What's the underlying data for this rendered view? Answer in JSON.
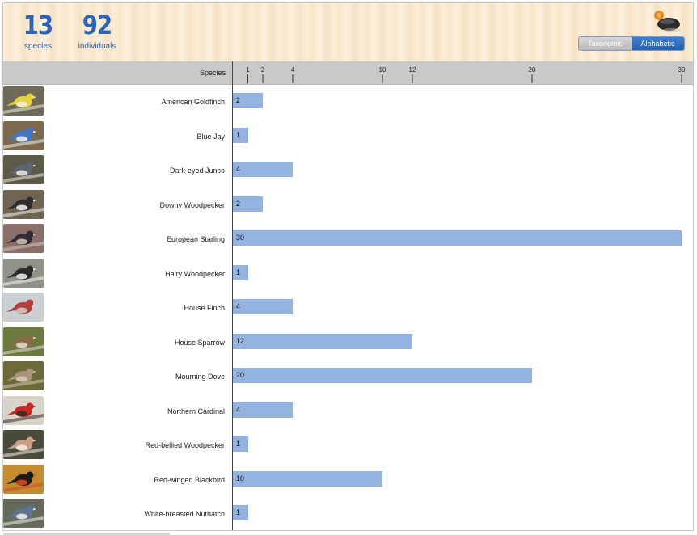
{
  "summary": {
    "species_count": "13",
    "species_label": "species",
    "individuals_count": "92",
    "individuals_label": "individuals"
  },
  "view_toggle": {
    "taxonomic": "Taxonomic",
    "alphabetic": "Alphabetic",
    "selected": "Alphabetic"
  },
  "column_header": "Species",
  "colors": {
    "bar": "#95b3e0",
    "accent": "#2a63b8",
    "header_bg": "#c9c9c9"
  },
  "chart_data": {
    "type": "bar",
    "orientation": "horizontal",
    "xlabel": "",
    "ylabel": "Species",
    "xlim": [
      0,
      30
    ],
    "ticks": [
      1,
      2,
      4,
      10,
      12,
      20,
      30
    ],
    "categories": [
      "American Goldfinch",
      "Blue Jay",
      "Dark-eyed Junco",
      "Downy Woodpecker",
      "European Starling",
      "Hairy Woodpecker",
      "House Finch",
      "House Sparrow",
      "Mourning Dove",
      "Northern Cardinal",
      "Red-bellied Woodpecker",
      "Red-winged Blackbird",
      "White-breasted Nuthatch"
    ],
    "values": [
      2,
      1,
      4,
      2,
      30,
      1,
      4,
      12,
      20,
      4,
      1,
      10,
      1
    ],
    "thumbnail_icons": [
      "american-goldfinch-photo",
      "blue-jay-photo",
      "dark-eyed-junco-photo",
      "downy-woodpecker-photo",
      "european-starling-photo",
      "hairy-woodpecker-photo",
      "house-finch-photo",
      "house-sparrow-photo",
      "mourning-dove-photo",
      "northern-cardinal-photo",
      "red-bellied-woodpecker-photo",
      "red-winged-blackbird-photo",
      "white-breasted-nuthatch-photo"
    ],
    "thumbnail_colors": [
      [
        "#6f6a57",
        "#e8d23a",
        "#f2eee0"
      ],
      [
        "#7d6a4c",
        "#3f78c9",
        "#f1f1f1"
      ],
      [
        "#5d5a48",
        "#5e6570",
        "#ece9e4"
      ],
      [
        "#6f6352",
        "#2f2d2b",
        "#f4f2ee"
      ],
      [
        "#8a6e68",
        "#2f2a36",
        "#cfc6b6"
      ],
      [
        "#8f9289",
        "#2a2a2a",
        "#f3f3f3"
      ],
      [
        "#c9cfd3",
        "#b33a3d",
        "#d8cfc4"
      ],
      [
        "#6b7a3e",
        "#8a6a47",
        "#e3ddd0"
      ],
      [
        "#6d6a3a",
        "#a8927a",
        "#d5c8b3"
      ],
      [
        "#d8d3cb",
        "#c42a23",
        "#3a2b22"
      ],
      [
        "#4a4a3b",
        "#c89f84",
        "#f2eee6"
      ],
      [
        "#c58b2f",
        "#1b1a18",
        "#d74b2a"
      ],
      [
        "#646b5a",
        "#5f7494",
        "#f0efec"
      ]
    ]
  }
}
